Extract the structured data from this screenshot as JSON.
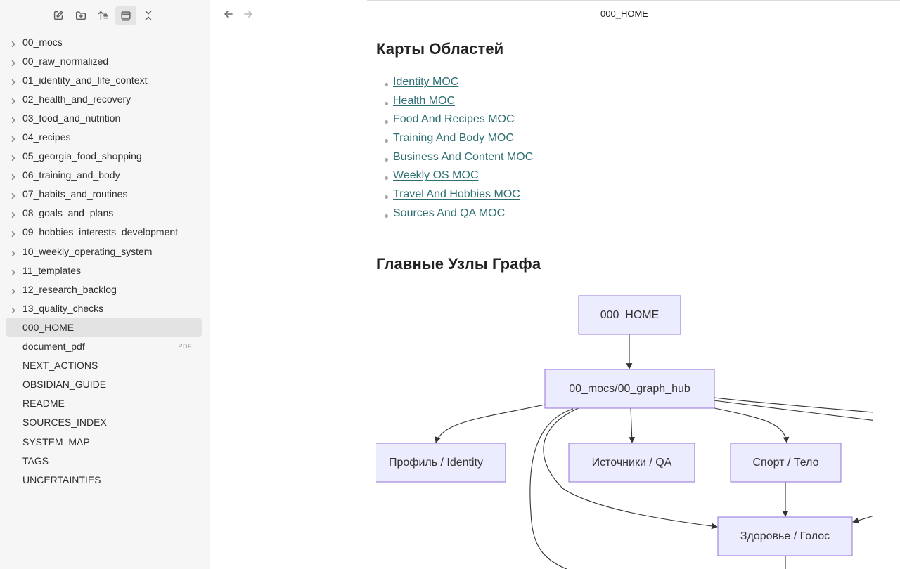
{
  "sidebar": {
    "toolbar": [
      {
        "name": "new-note-icon"
      },
      {
        "name": "new-folder-icon"
      },
      {
        "name": "sort-icon"
      },
      {
        "name": "change-view-icon"
      },
      {
        "name": "collapse-all-icon"
      }
    ],
    "folders": [
      "00_mocs",
      "00_raw_normalized",
      "01_identity_and_life_context",
      "02_health_and_recovery",
      "03_food_and_nutrition",
      "04_recipes",
      "05_georgia_food_shopping",
      "06_training_and_body",
      "07_habits_and_routines",
      "08_goals_and_plans",
      "09_hobbies_interests_development",
      "10_weekly_operating_system",
      "11_templates",
      "12_research_backlog",
      "13_quality_checks"
    ],
    "files": [
      {
        "label": "000_HOME",
        "selected": true
      },
      {
        "label": "document_pdf",
        "badge": "PDF"
      },
      {
        "label": "NEXT_ACTIONS"
      },
      {
        "label": "OBSIDIAN_GUIDE"
      },
      {
        "label": "README"
      },
      {
        "label": "SOURCES_INDEX"
      },
      {
        "label": "SYSTEM_MAP"
      },
      {
        "label": "TAGS"
      },
      {
        "label": "UNCERTAINTIES"
      }
    ]
  },
  "header": {
    "title": "000_HOME"
  },
  "note": {
    "areas_heading": "Карты Областей",
    "moc_links": [
      "Identity MOC",
      "Health MOC",
      "Food And Recipes MOC",
      "Training And Body MOC",
      "Business And Content MOC",
      "Weekly OS MOC",
      "Travel And Hobbies MOC",
      "Sources And QA MOC"
    ],
    "graph_heading": "Главные Узлы Графа"
  },
  "graph": {
    "nodes": [
      {
        "id": "home",
        "label": "000_HOME"
      },
      {
        "id": "hub",
        "label": "00_mocs/00_graph_hub"
      },
      {
        "id": "identity",
        "label": "Профиль / Identity"
      },
      {
        "id": "sources",
        "label": "Источники / QA"
      },
      {
        "id": "sport",
        "label": "Спорт / Тело"
      },
      {
        "id": "health",
        "label": "Здоровье / Голос"
      }
    ]
  }
}
